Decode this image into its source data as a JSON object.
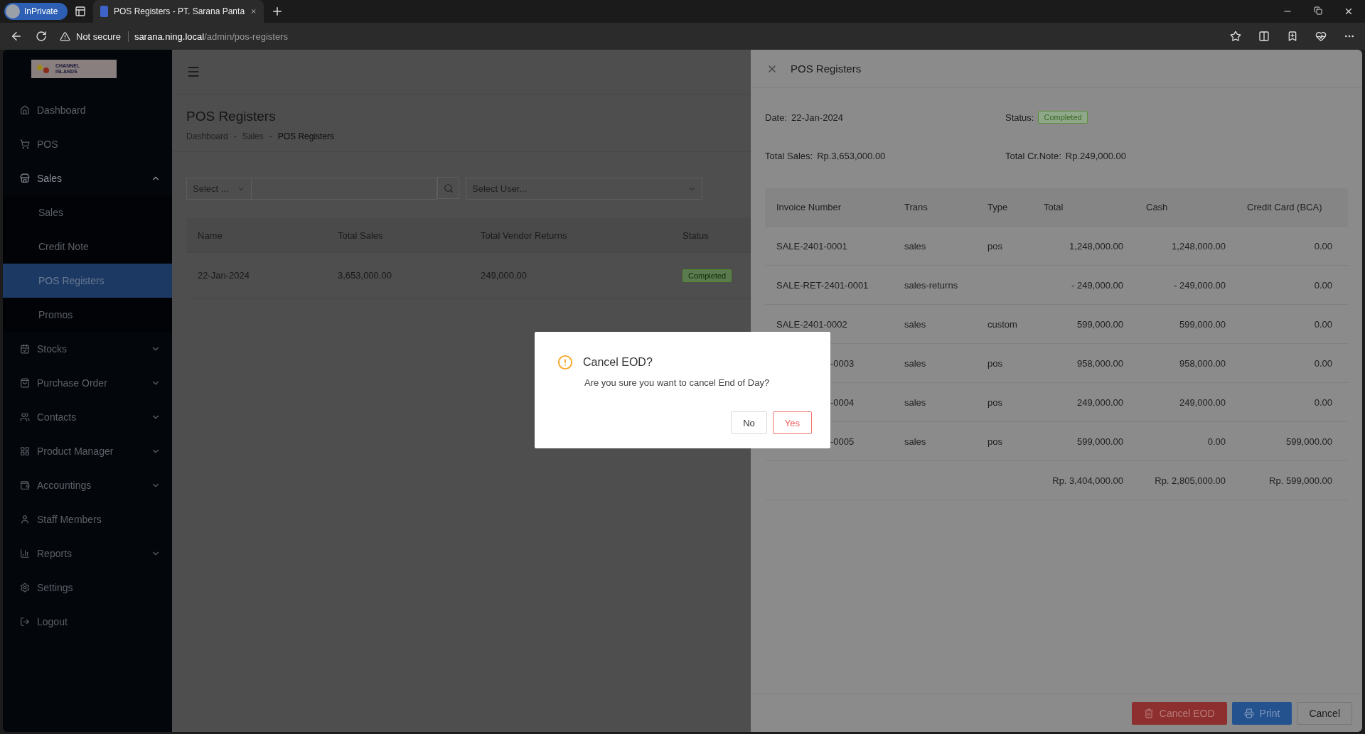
{
  "browser": {
    "private_label": "InPrivate",
    "tab_title": "POS Registers - PT. Sarana Panta",
    "security": "Not secure",
    "url_host": "sarana.ning.local",
    "url_path": "/admin/pos-registers"
  },
  "sidebar": {
    "logo": [
      "CHANNEL",
      "ISLANDS"
    ],
    "items": [
      {
        "label": "Dashboard",
        "has_submenu": false,
        "selected": false
      },
      {
        "label": "POS",
        "has_submenu": false,
        "selected": false
      },
      {
        "label": "Sales",
        "has_submenu": true,
        "expanded": true,
        "selected": false,
        "children": [
          {
            "label": "Sales",
            "selected": false
          },
          {
            "label": "Credit Note",
            "selected": false
          },
          {
            "label": "POS Registers",
            "selected": true
          },
          {
            "label": "Promos",
            "selected": false
          }
        ]
      },
      {
        "label": "Stocks",
        "has_submenu": true,
        "expanded": false,
        "selected": false
      },
      {
        "label": "Purchase Order",
        "has_submenu": true,
        "expanded": false,
        "selected": false
      },
      {
        "label": "Contacts",
        "has_submenu": true,
        "expanded": false,
        "selected": false
      },
      {
        "label": "Product Manager",
        "has_submenu": true,
        "expanded": false,
        "selected": false
      },
      {
        "label": "Accountings",
        "has_submenu": true,
        "expanded": false,
        "selected": false
      },
      {
        "label": "Staff Members",
        "has_submenu": false,
        "selected": false
      },
      {
        "label": "Reports",
        "has_submenu": true,
        "expanded": false,
        "selected": false
      },
      {
        "label": "Settings",
        "has_submenu": false,
        "selected": false
      },
      {
        "label": "Logout",
        "has_submenu": false,
        "selected": false
      }
    ]
  },
  "page": {
    "title": "POS Registers",
    "breadcrumb": [
      "Dashboard",
      "Sales",
      "POS Registers"
    ],
    "breadcrumb_separator": "-",
    "filters": {
      "select_placeholder": "Select ...",
      "user_placeholder": "Select User..."
    },
    "table": {
      "columns": [
        "Name",
        "Total Sales",
        "Total Vendor Returns",
        "Status"
      ],
      "rows": [
        {
          "cells": [
            "22-Jan-2024",
            "3,653,000.00",
            "249,000.00"
          ],
          "status": "Completed"
        }
      ]
    }
  },
  "drawer": {
    "title": "POS Registers",
    "fields": [
      {
        "label": "Date:",
        "kind": "text",
        "value": "22-Jan-2024"
      },
      {
        "label": "Status:",
        "kind": "tag",
        "value": "Completed"
      },
      {
        "label": "Total Sales:",
        "kind": "text",
        "value": "Rp.3,653,000.00"
      },
      {
        "label": "Total Cr.Note:",
        "kind": "text",
        "value": "Rp.249,000.00"
      }
    ],
    "table": {
      "columns": [
        "Invoice Number",
        "Trans",
        "Type",
        "Total",
        "Cash",
        "Credit Card (BCA)"
      ],
      "rows": [
        {
          "invoice": "SALE-2401-0001",
          "partial": false,
          "trans": "sales",
          "type": "pos",
          "total": "1,248,000.00",
          "cash": "1,248,000.00",
          "card": "0.00"
        },
        {
          "invoice": "SALE-RET-2401-0001",
          "partial": false,
          "trans": "sales-returns",
          "total": "- 249,000.00",
          "cash": "- 249,000.00",
          "card": "0.00"
        },
        {
          "invoice": "SALE-2401-0002",
          "partial": false,
          "trans": "sales",
          "type": "custom",
          "total": "599,000.00",
          "cash": "599,000.00",
          "card": "0.00"
        },
        {
          "invoice": "-0003",
          "partial": true,
          "trans": "sales",
          "type": "pos",
          "total": "958,000.00",
          "cash": "958,000.00",
          "card": "0.00"
        },
        {
          "invoice": "-0004",
          "partial": true,
          "trans": "sales",
          "type": "pos",
          "total": "249,000.00",
          "cash": "249,000.00",
          "card": "0.00"
        },
        {
          "invoice": "-0005",
          "partial": true,
          "trans": "sales",
          "type": "pos",
          "total": "599,000.00",
          "cash": "0.00",
          "card": "599,000.00"
        }
      ],
      "totals": {
        "total": "Rp. 3,404,000.00",
        "cash": "Rp. 2,805,000.00",
        "card": "Rp. 599,000.00"
      }
    },
    "buttons": [
      {
        "label": "Cancel EOD",
        "kind": "danger"
      },
      {
        "label": "Print",
        "kind": "primary"
      },
      {
        "label": "Cancel",
        "kind": "default"
      }
    ]
  },
  "dialog": {
    "title": "Cancel EOD?",
    "message": "Are you sure you want to cancel End of Day?",
    "buttons": [
      {
        "label": "No",
        "kind": "default"
      },
      {
        "label": "Yes",
        "kind": "danger"
      }
    ]
  }
}
